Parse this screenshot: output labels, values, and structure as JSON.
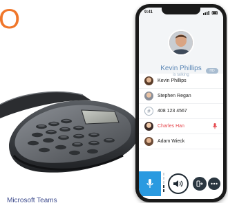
{
  "corner_glyph": "O",
  "caption": "Microsoft Teams",
  "phone": {
    "status": {
      "time": "9:41"
    },
    "caller": {
      "name": "Kevin Phillips",
      "status": "is talking",
      "badge": "HD"
    },
    "participants": [
      {
        "name": "Kevin Phillips",
        "avatar": "photo",
        "state": "normal"
      },
      {
        "name": "Stephen Regan",
        "avatar": "photo",
        "state": "normal"
      },
      {
        "name": "408 123 4567",
        "avatar": "#",
        "state": "normal"
      },
      {
        "name": "Charles Han",
        "avatar": "photo",
        "state": "muted",
        "icon": "mic-off-icon"
      },
      {
        "name": "Adam Wieck",
        "avatar": "photo",
        "state": "normal"
      }
    ],
    "controls": {
      "mic_icon": "microphone-icon",
      "speaker_icon": "speaker-icon",
      "transfer_icon": "transfer-icon",
      "more_icon": "more-icon"
    }
  },
  "colors": {
    "accent_orange": "#f0772b",
    "caller_blue": "#5a86b5",
    "muted_red": "#e5484d",
    "mic_blue": "#2a9ae0",
    "caption_blue": "#3c4a8c"
  }
}
